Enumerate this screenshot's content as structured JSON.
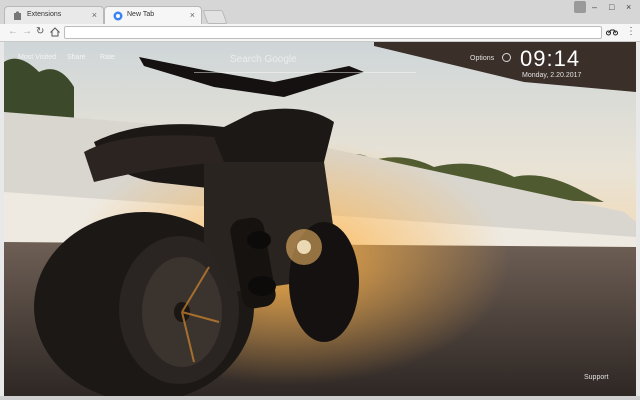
{
  "tabs": [
    {
      "title": "Extensions",
      "active": false
    },
    {
      "title": "New Tab",
      "active": true
    }
  ],
  "toolbar": {
    "url": ""
  },
  "page": {
    "nav": [
      "Most Visited",
      "Share",
      "Rate"
    ],
    "search_placeholder": "Search Google",
    "options_label": "Options",
    "time": "09:14",
    "date": "Monday, 2.20.2017",
    "support_label": "Support"
  },
  "icons": {
    "back": "back-arrow-icon",
    "forward": "forward-arrow-icon",
    "reload": "reload-icon",
    "home": "home-icon",
    "extension": "motorcycle-extension-icon",
    "menu": "menu-icon",
    "clock": "clock-icon"
  },
  "colors": {
    "accent": "#ff9a2e",
    "text_on_image": "#ffffff"
  }
}
